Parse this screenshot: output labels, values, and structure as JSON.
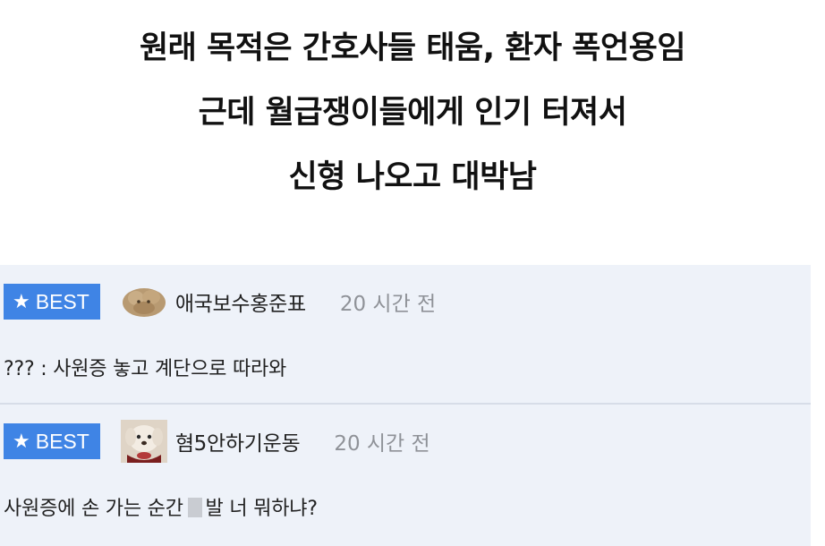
{
  "caption": {
    "lines": [
      "원래 목적은 간호사들 태움, 환자 폭언용임",
      "근데 월급쟁이들에게 인기 터져서",
      "신형 나오고 대박남"
    ]
  },
  "comments": [
    {
      "badge": "BEST",
      "badge_icon": "star-icon",
      "avatar_icon": "fluffy-dog-avatar",
      "nickname": "애국보수홍준표",
      "time": "20 시간 전",
      "text": "??? : 사원증 놓고 계단으로 따라와"
    },
    {
      "badge": "BEST",
      "badge_icon": "star-icon",
      "avatar_icon": "puppy-avatar",
      "nickname": "혐5안하기운동",
      "time": "20 시간 전",
      "text_before_censor": "사원증에 손 가는 순간 ",
      "text_after_censor": "발 너 뭐하냐?"
    }
  ],
  "colors": {
    "badge_background": "#3f84e5",
    "comment_background": "#eef2f9",
    "time_text": "#8f9298"
  }
}
